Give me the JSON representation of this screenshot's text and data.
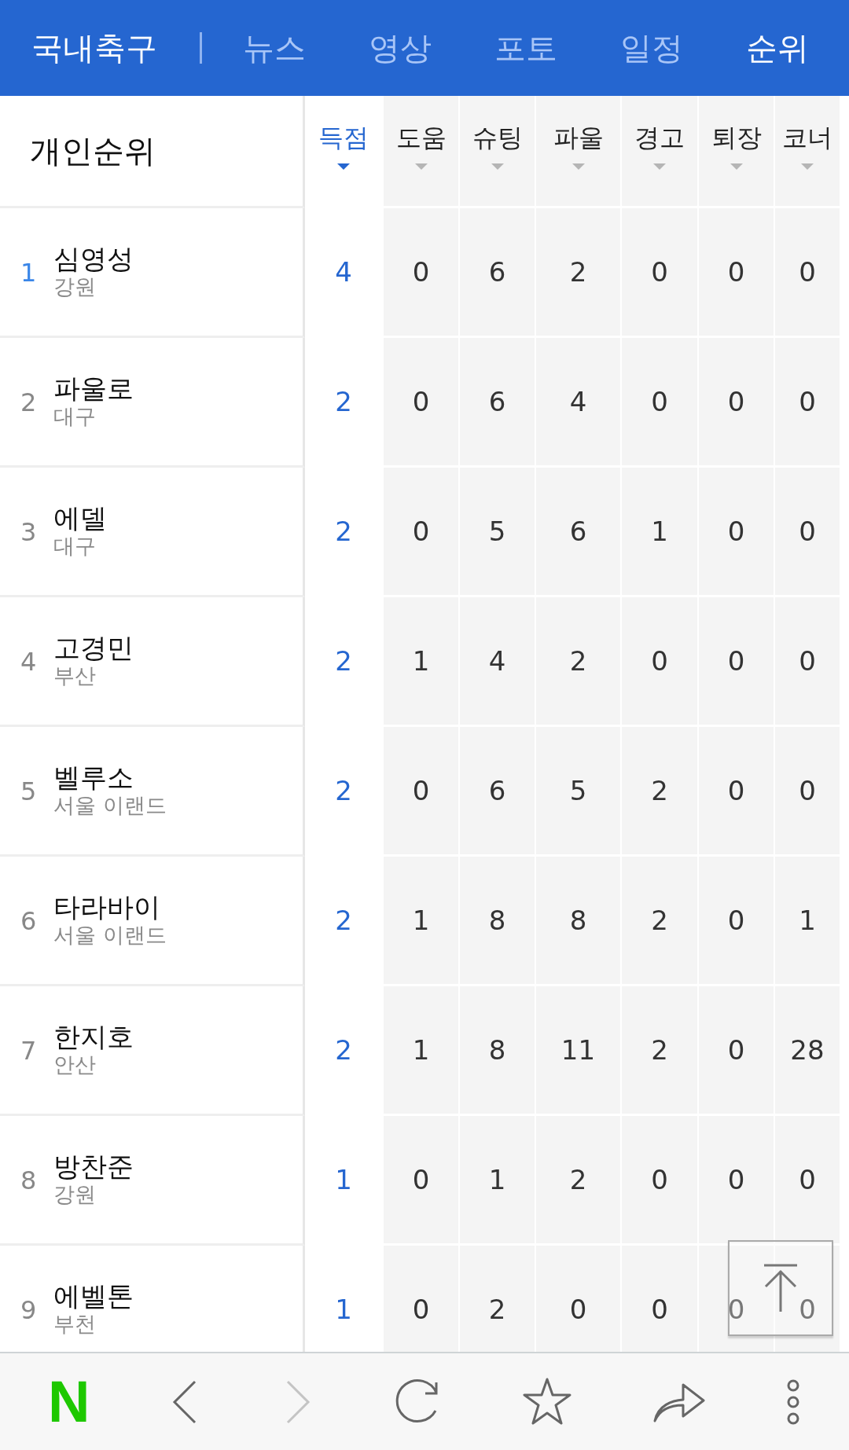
{
  "header": {
    "title": "국내축구",
    "tabs": [
      {
        "label": "뉴스",
        "selected": false
      },
      {
        "label": "영상",
        "selected": false
      },
      {
        "label": "포토",
        "selected": false
      },
      {
        "label": "일정",
        "selected": false
      },
      {
        "label": "순위",
        "selected": true
      }
    ]
  },
  "table": {
    "title": "개인순위",
    "columns": [
      {
        "label": "득점",
        "selected": true
      },
      {
        "label": "도움",
        "selected": false
      },
      {
        "label": "슈팅",
        "selected": false
      },
      {
        "label": "파울",
        "selected": false
      },
      {
        "label": "경고",
        "selected": false
      },
      {
        "label": "퇴장",
        "selected": false
      },
      {
        "label": "코너",
        "selected": false
      }
    ],
    "rows": [
      {
        "rank": "1",
        "highlighted": true,
        "name": "심영성",
        "team": "강원",
        "values": [
          "4",
          "0",
          "6",
          "2",
          "0",
          "0",
          "0"
        ]
      },
      {
        "rank": "2",
        "highlighted": false,
        "name": "파울로",
        "team": "대구",
        "values": [
          "2",
          "0",
          "6",
          "4",
          "0",
          "0",
          "0"
        ]
      },
      {
        "rank": "3",
        "highlighted": false,
        "name": "에델",
        "team": "대구",
        "values": [
          "2",
          "0",
          "5",
          "6",
          "1",
          "0",
          "0"
        ]
      },
      {
        "rank": "4",
        "highlighted": false,
        "name": "고경민",
        "team": "부산",
        "values": [
          "2",
          "1",
          "4",
          "2",
          "0",
          "0",
          "0"
        ]
      },
      {
        "rank": "5",
        "highlighted": false,
        "name": "벨루소",
        "team": "서울 이랜드",
        "values": [
          "2",
          "0",
          "6",
          "5",
          "2",
          "0",
          "0"
        ]
      },
      {
        "rank": "6",
        "highlighted": false,
        "name": "타라바이",
        "team": "서울 이랜드",
        "values": [
          "2",
          "1",
          "8",
          "8",
          "2",
          "0",
          "1"
        ]
      },
      {
        "rank": "7",
        "highlighted": false,
        "name": "한지호",
        "team": "안산",
        "values": [
          "2",
          "1",
          "8",
          "11",
          "2",
          "0",
          "28"
        ]
      },
      {
        "rank": "8",
        "highlighted": false,
        "name": "방찬준",
        "team": "강원",
        "values": [
          "1",
          "0",
          "1",
          "2",
          "0",
          "0",
          "0"
        ]
      },
      {
        "rank": "9",
        "highlighted": false,
        "name": "에벨톤",
        "team": "부천",
        "values": [
          "1",
          "0",
          "2",
          "0",
          "0",
          "0",
          "0"
        ]
      }
    ]
  },
  "bottom_bar": {
    "items": [
      {
        "kind": "logo",
        "label": "N",
        "disabled": false
      },
      {
        "kind": "back",
        "disabled": false
      },
      {
        "kind": "forward",
        "disabled": true
      },
      {
        "kind": "reload",
        "disabled": false
      },
      {
        "kind": "star",
        "disabled": false
      },
      {
        "kind": "share",
        "disabled": false
      },
      {
        "kind": "more",
        "disabled": false
      }
    ]
  }
}
